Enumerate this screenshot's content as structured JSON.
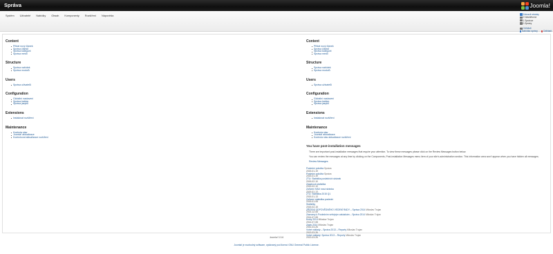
{
  "header": {
    "title": "Správa",
    "logo_text": "Joomla!"
  },
  "menu": [
    "Systém",
    "Uživatelé",
    "Nabídky",
    "Obsah",
    "Komponenty",
    "Rozšíření",
    "Nápověda"
  ],
  "status": {
    "items": [
      {
        "icon": "user-icon",
        "text": "Zobrazit stránky"
      },
      {
        "icon": "users-icon",
        "text": "0 Návštěvníci"
      },
      {
        "icon": "admin-icon",
        "text": "1 Správce"
      },
      {
        "icon": "mail-icon",
        "text": "0 Zprávy"
      }
    ],
    "logout": "Odhlásit",
    "hidden_menu": "Nabídka správy",
    "hidden_count": "0",
    "hidden_menu_label": "Odhlásit"
  },
  "left": {
    "sections": [
      {
        "title": "Content",
        "links": [
          "Přidat nový článek",
          "Správa článků",
          "Správa kategorií",
          "Správa médií"
        ]
      },
      {
        "title": "Structure",
        "links": [
          "Správa nabídek",
          "Správa modulů"
        ]
      },
      {
        "title": "Users",
        "links": [
          "Správa uživatelů"
        ]
      },
      {
        "title": "Configuration",
        "links": [
          "Globální nastavení",
          "Správa šablon",
          "Správa jazyků"
        ]
      },
      {
        "title": "Extensions",
        "links": [
          "Instalovat rozšíření"
        ]
      },
      {
        "title": "Maintenance",
        "links": [
          "Kontrola stav",
          "Joomla! aktualizace",
          "Kontrolovat aktualizace rozšíření"
        ]
      }
    ]
  },
  "right": {
    "sections": [
      {
        "title": "Content",
        "links": [
          "Přidat nový článek",
          "Správa článků",
          "Správa kategorií",
          "Správa médií"
        ]
      },
      {
        "title": "Structure",
        "links": [
          "Správa nabídek",
          "Správa modulů"
        ]
      },
      {
        "title": "Users",
        "links": [
          "Správa uživatelů"
        ]
      },
      {
        "title": "Configuration",
        "links": [
          "Globální nastavení",
          "Správa šablon",
          "Správa jazyků"
        ]
      },
      {
        "title": "Extensions",
        "links": [
          "Instalovat rozšíření"
        ]
      },
      {
        "title": "Maintenance",
        "links": [
          "Kontrola stav",
          "Joomla! aktualizace",
          "Kontrola stav aktualizace rozšíření"
        ]
      }
    ],
    "messages": {
      "title": "You have post-installation messages",
      "p1": "There are important post-installation messages that require your attention. To view these messages please click on the Review Messages button below.",
      "p2": "You can review the messages at any time by clicking on the Components, Post-installation Messages menu item of your site's administration section. This information area won't appear when you have hidden all messages.",
      "review": "Review Messages"
    },
    "feed": [
      {
        "t": "Poslední položka",
        "a": "Správa",
        "d": "2015-01-19"
      },
      {
        "t": "Poslední položka",
        "a": "Správa",
        "d": "2015-01-19"
      },
      {
        "t": "ZTU: Statistika posledních stránek",
        "a": "",
        "d": "2015-02-10"
      },
      {
        "t": "Zásahová statistika",
        "a": "",
        "d": "2015-02-10"
      },
      {
        "t": "Zařízení MIUI nová stránka",
        "a": "",
        "d": "2015-01-13"
      },
      {
        "t": "ZTU: Statistika 2015 Q1",
        "a": "",
        "d": "2015-01-13"
      },
      {
        "t": "Zařízení statistika poslední",
        "a": "",
        "d": "2015-01-08"
      },
      {
        "t": "Statistiky",
        "a": "",
        "d": "2015-02-15"
      },
      {
        "t": "ZŘÍZENÍ ODPOVĚDNÉHO VEDENÍ RADY – Správa 2014",
        "a": "Miloslav Trojan",
        "d": "2014-12-08"
      },
      {
        "t": "Záznamy k Posledním veřejným zakázkám – Správa 2014",
        "a": "Miloslav Trojan",
        "d": "2014-07-08"
      },
      {
        "t": "Kroky 2014",
        "a": "Miloslav Trojan",
        "d": "2014-07-08"
      },
      {
        "t": "Zápis 2014",
        "a": "Miloslav Trojan",
        "d": "2014-03-26"
      },
      {
        "t": "Volné náklady – Správa 2013 – Reporty",
        "a": "Miloslav Trojan",
        "d": "2013-03-26"
      },
      {
        "t": "Volné náklady: Správa 2013 – Reporty",
        "a": "Miloslav Trojan",
        "d": "2013-03-26"
      }
    ]
  },
  "footer": {
    "version": "Joomla! 3.3.6",
    "license": "Joomla! je svobodný software, vydávaný pod licencí GNU General Public License."
  }
}
